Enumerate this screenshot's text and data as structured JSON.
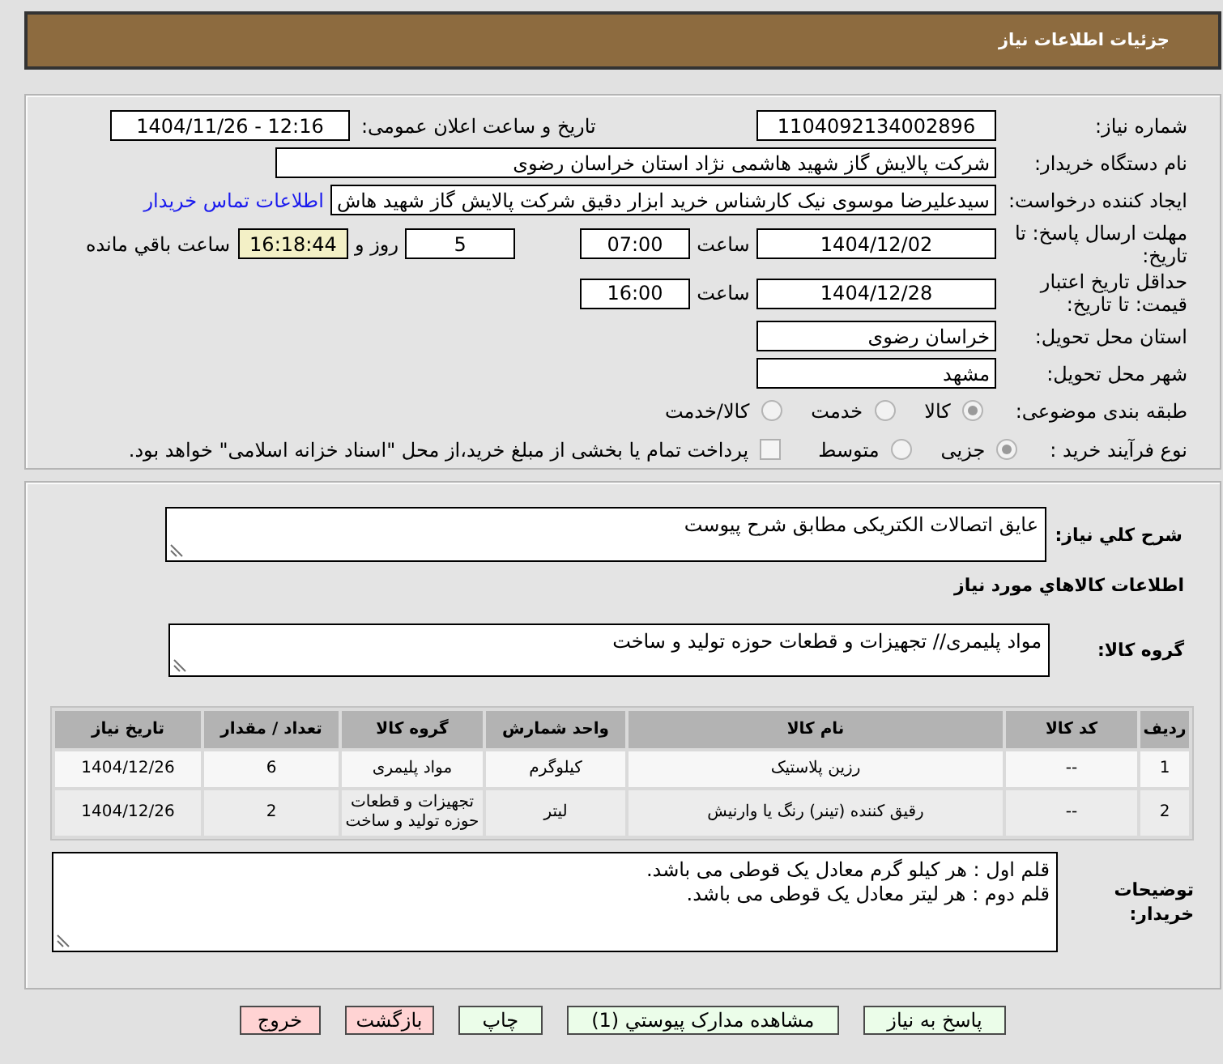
{
  "header": {
    "title": "جزئیات اطلاعات نیاز"
  },
  "details": {
    "need_number": {
      "label": "شماره نیاز:",
      "value": "1104092134002896"
    },
    "announcement": {
      "label": "تاریخ و ساعت اعلان عمومی:",
      "value": "1404/11/26 - 12:16"
    },
    "buyer": {
      "label": "نام دستگاه خریدار:",
      "value": "شرکت پالایش گاز شهید هاشمی نژاد   استان خراسان رضوی"
    },
    "requester": {
      "label": "ایجاد کننده درخواست:",
      "value": "سیدعلیرضا موسوی نیک کارشناس خرید ابزار دقیق شرکت پالایش گاز شهید هاش",
      "contact_link": "اطلاعات تماس خریدار"
    },
    "reply_deadline": {
      "label": "مهلت ارسال پاسخ: تا تاریخ:",
      "date": "1404/12/02",
      "time_label": "ساعت",
      "time": "07:00",
      "days": "5",
      "days_label": "روز و",
      "remaining": "16:18:44",
      "remaining_label": "ساعت باقي مانده"
    },
    "price_validity": {
      "label": "حداقل تاریخ اعتبار قیمت: تا تاریخ:",
      "date": "1404/12/28",
      "time_label": "ساعت",
      "time": "16:00"
    },
    "delivery_province": {
      "label": "استان محل تحویل:",
      "value": "خراسان رضوی"
    },
    "delivery_city": {
      "label": "شهر محل تحویل:",
      "value": "مشهد"
    },
    "category": {
      "label": "طبقه بندی موضوعی:",
      "options": [
        {
          "label": "کالا",
          "selected": true
        },
        {
          "label": "خدمت",
          "selected": false
        },
        {
          "label": "کالا/خدمت",
          "selected": false
        }
      ]
    },
    "purchase_process": {
      "label": "نوع فرآیند خرید :",
      "options": [
        {
          "label": "جزیی",
          "selected": true
        },
        {
          "label": "متوسط",
          "selected": false
        }
      ],
      "treasury_payment": {
        "label": "پرداخت تمام یا بخشی از مبلغ خرید،از محل \"اسناد خزانه اسلامی\" خواهد بود.",
        "checked": false
      }
    }
  },
  "goods": {
    "description": {
      "label": "شرح كلي نیاز:",
      "value": "عایق اتصالات الکتریکی مطابق شرح پیوست"
    },
    "section_title": "اطلاعات كالاهاي مورد نیاز",
    "group": {
      "label": "گروه کالا:",
      "value": "مواد پلیمری// تجهیزات و قطعات حوزه تولید و ساخت"
    },
    "table": {
      "columns": [
        "ردیف",
        "کد کالا",
        "نام کالا",
        "واحد شمارش",
        "گروه کالا",
        "تعداد / مقدار",
        "تاریخ نیاز"
      ],
      "rows": [
        [
          "1",
          "--",
          "رزین پلاستیک",
          "کیلوگرم",
          "مواد پلیمری",
          "6",
          "1404/12/26"
        ],
        [
          "2",
          "--",
          "رقیق کننده (تینر) رنگ یا وارنیش",
          "لیتر",
          "تجهیزات و قطعات حوزه تولید و ساخت",
          "2",
          "1404/12/26"
        ]
      ]
    },
    "buyer_notes": {
      "label": "توضیحات خریدار:",
      "lines": [
        "قلم اول : هر کیلو گرم معادل یک قوطی می باشد.",
        "قلم دوم : هر لیتر معادل یک قوطی می باشد."
      ]
    }
  },
  "buttons": [
    {
      "label": "پاسخ به نیاز",
      "kind": "confirm"
    },
    {
      "label": "مشاهده مدارک پیوستي (1)",
      "kind": "confirm"
    },
    {
      "label": "چاپ",
      "kind": "confirm"
    },
    {
      "label": "بازگشت",
      "kind": "cancel"
    },
    {
      "label": "خروج",
      "kind": "cancel"
    }
  ]
}
